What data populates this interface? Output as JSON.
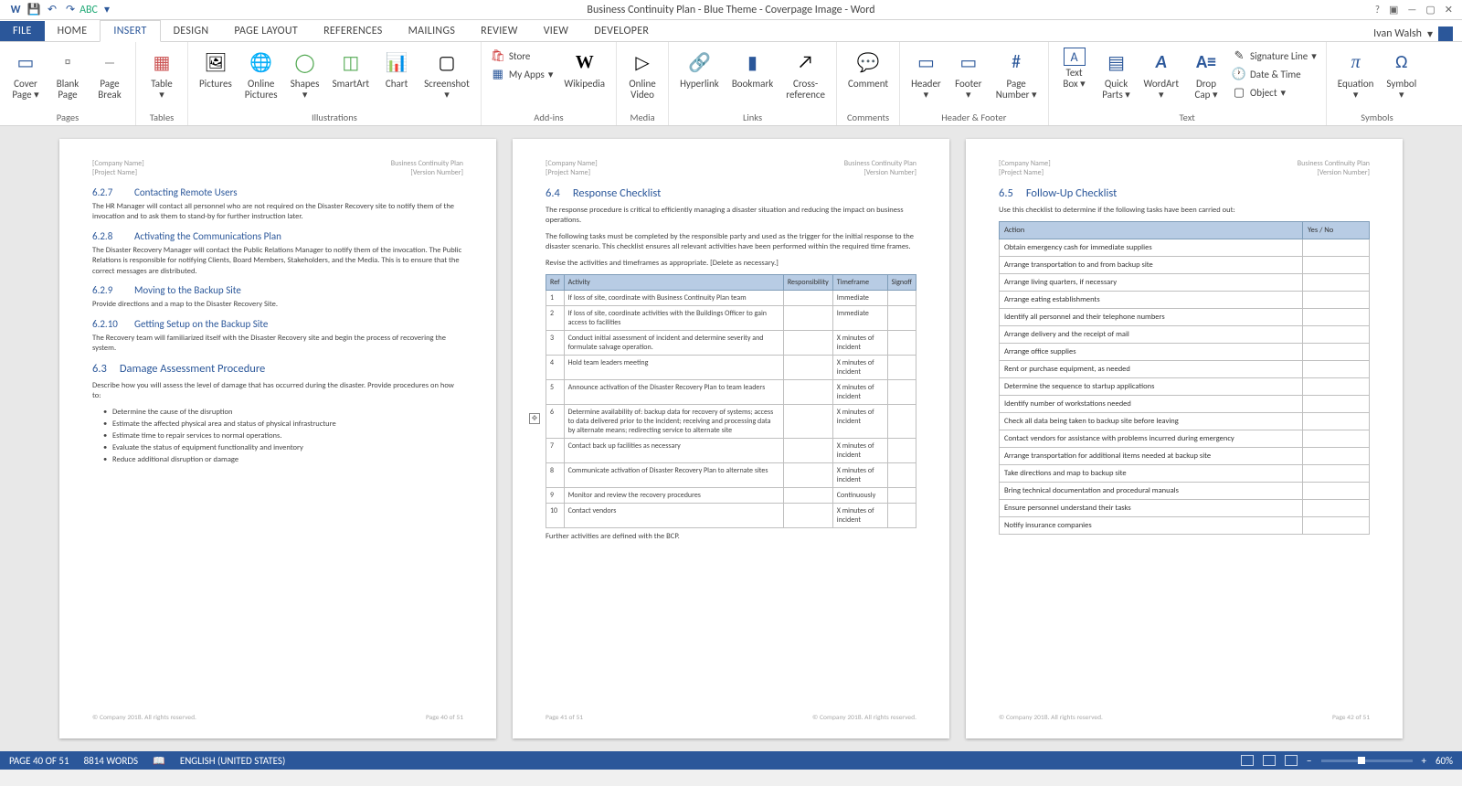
{
  "window": {
    "title": "Business Continuity Plan - Blue Theme - Coverpage Image - Word",
    "user": "Ivan Walsh"
  },
  "qat": {
    "save": "💾",
    "undo": "↶",
    "redo": "↷",
    "spell": "✓",
    "touch": "☰"
  },
  "tabs": [
    "FILE",
    "HOME",
    "INSERT",
    "DESIGN",
    "PAGE LAYOUT",
    "REFERENCES",
    "MAILINGS",
    "REVIEW",
    "VIEW",
    "DEVELOPER"
  ],
  "active_tab": "INSERT",
  "ribbon": {
    "pages": {
      "label": "Pages",
      "items": [
        {
          "label": "Cover\nPage",
          "icon": "▭"
        },
        {
          "label": "Blank\nPage",
          "icon": "▫"
        },
        {
          "label": "Page\nBreak",
          "icon": "⎯"
        }
      ]
    },
    "tables": {
      "label": "Tables",
      "items": [
        {
          "label": "Table",
          "icon": "▦"
        }
      ]
    },
    "illustrations": {
      "label": "Illustrations",
      "items": [
        {
          "label": "Pictures",
          "icon": "🖼"
        },
        {
          "label": "Online\nPictures",
          "icon": "🌐"
        },
        {
          "label": "Shapes",
          "icon": "◯"
        },
        {
          "label": "SmartArt",
          "icon": "◫"
        },
        {
          "label": "Chart",
          "icon": "📊"
        },
        {
          "label": "Screenshot",
          "icon": "▢"
        }
      ]
    },
    "addins": {
      "label": "Add-ins",
      "store": "Store",
      "myapps": "My Apps",
      "wikipedia": "Wikipedia"
    },
    "media": {
      "label": "Media",
      "items": [
        {
          "label": "Online\nVideo",
          "icon": "▷"
        }
      ]
    },
    "links": {
      "label": "Links",
      "items": [
        {
          "label": "Hyperlink",
          "icon": "🔗"
        },
        {
          "label": "Bookmark",
          "icon": "▮"
        },
        {
          "label": "Cross-\nreference",
          "icon": "↗"
        }
      ]
    },
    "comments": {
      "label": "Comments",
      "items": [
        {
          "label": "Comment",
          "icon": "💬"
        }
      ]
    },
    "hf": {
      "label": "Header & Footer",
      "items": [
        {
          "label": "Header",
          "icon": "▭"
        },
        {
          "label": "Footer",
          "icon": "▭"
        },
        {
          "label": "Page\nNumber",
          "icon": "#"
        }
      ]
    },
    "text": {
      "label": "Text",
      "items": [
        {
          "label": "Text\nBox",
          "icon": "A"
        },
        {
          "label": "Quick\nParts",
          "icon": "▤"
        },
        {
          "label": "WordArt",
          "icon": "A"
        },
        {
          "label": "Drop\nCap",
          "icon": "A"
        }
      ],
      "side": [
        "Signature Line",
        "Date & Time",
        "Object"
      ]
    },
    "symbols": {
      "label": "Symbols",
      "items": [
        {
          "label": "Equation",
          "icon": "π"
        },
        {
          "label": "Symbol",
          "icon": "Ω"
        }
      ]
    }
  },
  "doc_header": {
    "company": "[Company Name]",
    "project": "[Project Name]",
    "doc_title": "Business Continuity Plan",
    "version": "[Version Number]"
  },
  "page1": {
    "s627": {
      "num": "6.2.7",
      "title": "Contacting Remote Users",
      "body": "The HR Manager will contact all personnel who are not required on the Disaster Recovery site to notify them of the invocation and to ask them to stand-by for further instruction later."
    },
    "s628": {
      "num": "6.2.8",
      "title": "Activating the Communications Plan",
      "body": "The Disaster Recovery Manager will contact the Public Relations Manager to notify them of the invocation. The Public Relations is responsible for notifying Clients, Board Members, Stakeholders, and the Media. This is to ensure that the correct messages are distributed."
    },
    "s629": {
      "num": "6.2.9",
      "title": "Moving to the Backup Site",
      "body": "Provide directions and a map to the Disaster Recovery Site."
    },
    "s6210": {
      "num": "6.2.10",
      "title": "Getting Setup on the Backup Site",
      "body": "The Recovery team will familiarized itself with the Disaster Recovery site and begin the process of recovering the system."
    },
    "s63": {
      "num": "6.3",
      "title": "Damage Assessment Procedure",
      "body": "Describe how you will assess the level of damage that has occurred during the disaster. Provide procedures on how to:",
      "bullets": [
        "Determine the cause of the disruption",
        "Estimate the affected physical area and status of physical infrastructure",
        "Estimate time to repair services to normal operations.",
        "Evaluate the status of equipment functionality and inventory",
        "Reduce additional disruption or damage"
      ]
    },
    "foot_l": "© Company 2018. All rights reserved.",
    "foot_r": "Page 40 of 51"
  },
  "page2": {
    "s64": {
      "num": "6.4",
      "title": "Response Checklist",
      "p1": "The response procedure is critical to efficiently managing a disaster situation and reducing the impact on business operations.",
      "p2": "The following tasks must be completed by the responsible party and used as the trigger for the initial response to the disaster scenario. This checklist ensures all relevant activities have been performed within the required time frames.",
      "p3": "Revise the activities and timeframes as appropriate. [Delete as necessary.]"
    },
    "resp_head": [
      "Ref",
      "Activity",
      "Responsibility",
      "Timeframe",
      "Signoff"
    ],
    "resp_rows": [
      {
        "ref": "1",
        "act": "If loss of site, coordinate with Business Continuity Plan team",
        "tf": "Immediate"
      },
      {
        "ref": "2",
        "act": "If loss of site, coordinate activities with the Buildings Officer to gain access to facilities",
        "tf": "Immediate"
      },
      {
        "ref": "3",
        "act": "Conduct initial assessment of incident and determine severity and formulate salvage operation.",
        "tf": "X minutes of incident"
      },
      {
        "ref": "4",
        "act": "Hold team leaders meeting",
        "tf": "X minutes of incident"
      },
      {
        "ref": "5",
        "act": "Announce activation of the Disaster Recovery Plan to team leaders",
        "tf": "X minutes of incident"
      },
      {
        "ref": "6",
        "act": "Determine availability of: backup data for recovery of systems; access to data delivered prior to the incident; receiving and processing data by alternate means; redirecting service to alternate site",
        "tf": "X minutes of incident"
      },
      {
        "ref": "7",
        "act": "Contact back up facilities as necessary",
        "tf": "X minutes of incident"
      },
      {
        "ref": "8",
        "act": "Communicate activation of Disaster Recovery Plan to alternate sites",
        "tf": "X minutes of incident"
      },
      {
        "ref": "9",
        "act": "Monitor and review the recovery procedures",
        "tf": "Continuously"
      },
      {
        "ref": "10",
        "act": "Contact vendors",
        "tf": "X minutes of incident"
      }
    ],
    "after": "Further activities are defined with the BCP.",
    "foot_l": "Page 41 of 51",
    "foot_r": "© Company 2018. All rights reserved."
  },
  "page3": {
    "s65": {
      "num": "6.5",
      "title": "Follow-Up Checklist",
      "body": "Use this checklist to determine if the following tasks have been carried out:"
    },
    "fu_head": [
      "Action",
      "Yes / No"
    ],
    "fu_rows": [
      "Obtain emergency cash for immediate supplies",
      "Arrange transportation to and from backup site",
      "Arrange living quarters, if necessary",
      "Arrange eating establishments",
      "Identify all personnel and their telephone numbers",
      "Arrange delivery and the receipt of mail",
      "Arrange office supplies",
      "Rent or purchase equipment, as needed",
      "Determine the sequence to startup applications",
      "Identify number of workstations needed",
      "Check all data being taken to backup site before leaving",
      "Contact vendors for assistance with problems incurred during emergency",
      "Arrange transportation for additional items needed at backup site",
      "Take directions and map to backup site",
      "Bring technical documentation and procedural manuals",
      "Ensure personnel understand their tasks",
      "Notify insurance companies"
    ],
    "foot_l": "© Company 2018. All rights reserved.",
    "foot_r": "Page 42 of 51"
  },
  "statusbar": {
    "page": "PAGE 40 OF 51",
    "words": "8814 WORDS",
    "lang": "ENGLISH (UNITED STATES)",
    "zoom": "60%"
  }
}
